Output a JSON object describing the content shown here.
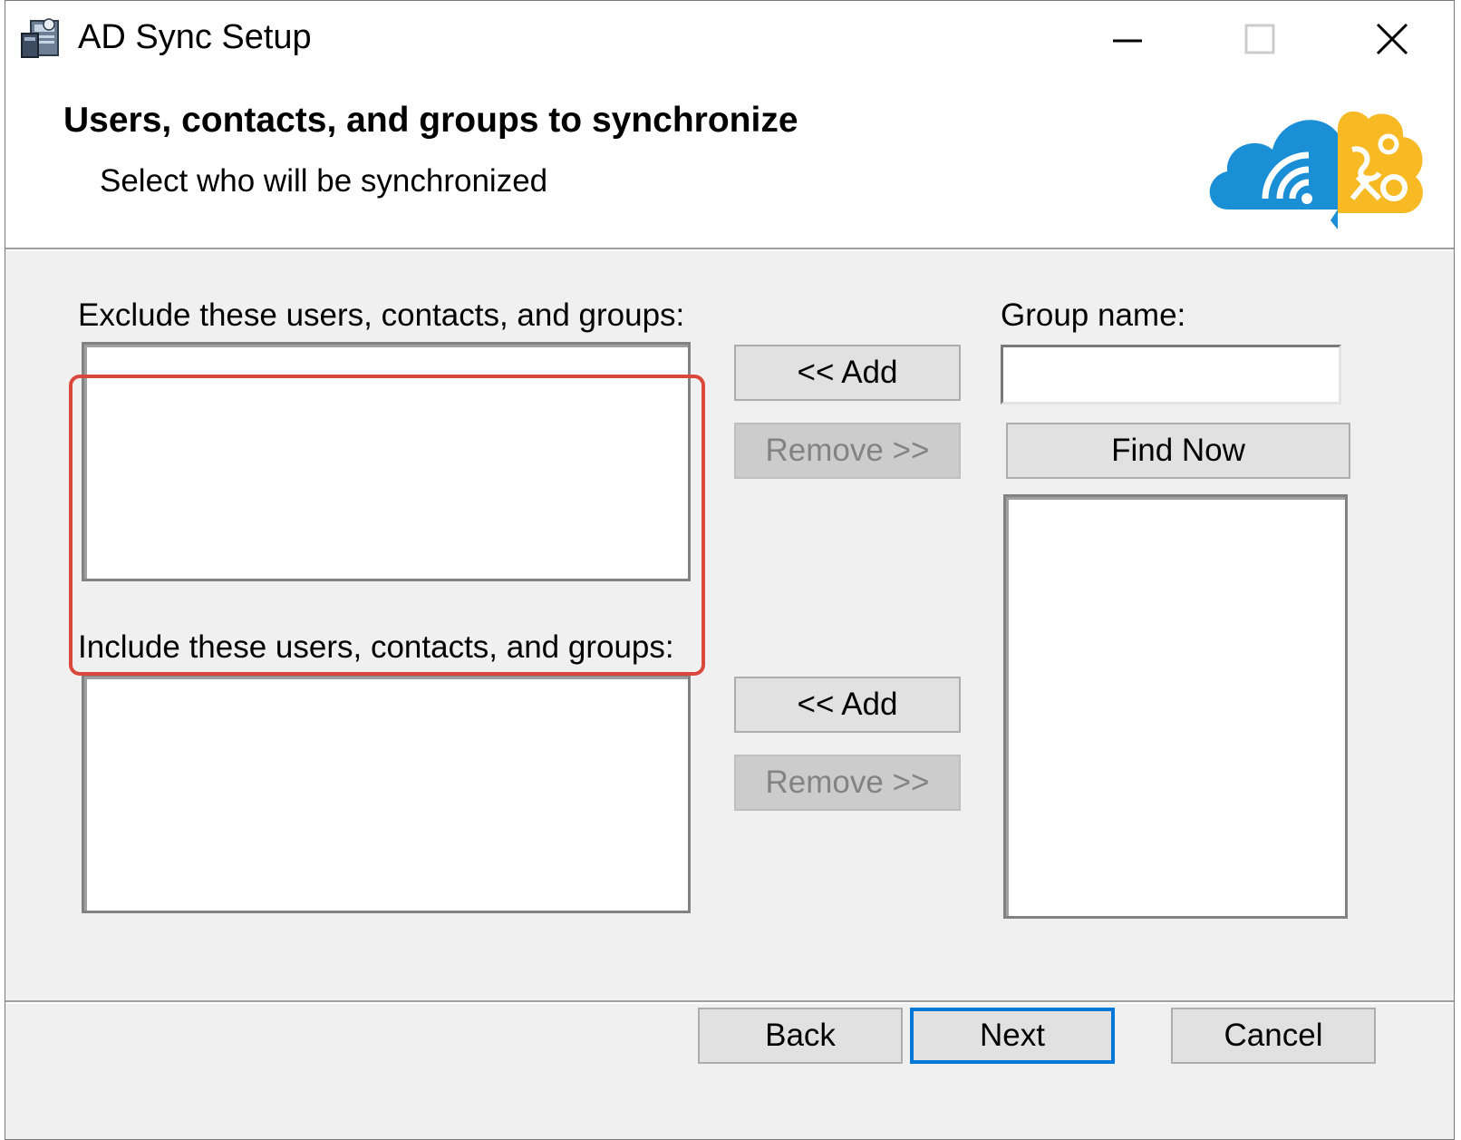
{
  "window": {
    "title": "AD Sync Setup",
    "icons": {
      "app": "installer-icon",
      "minimize": "minimize-icon",
      "maximize": "maximize-icon",
      "close": "close-icon"
    }
  },
  "header": {
    "heading": "Users, contacts, and groups to synchronize",
    "subheading": "Select who will be synchronized",
    "logo": "cloud-sync-logo"
  },
  "exclude": {
    "label": "Exclude these users, contacts, and groups:",
    "add_label": "<< Add",
    "remove_label": "Remove >>"
  },
  "include": {
    "label": "Include these users, contacts, and groups:",
    "add_label": "<< Add",
    "remove_label": "Remove >>"
  },
  "search": {
    "group_name_label": "Group name:",
    "group_name_value": "",
    "find_now_label": "Find Now"
  },
  "footer": {
    "back_label": "Back",
    "next_label": "Next",
    "cancel_label": "Cancel"
  },
  "colors": {
    "highlight": "#d9483b",
    "default_button_border": "#0078d7",
    "logo_blue": "#1a8fd6",
    "logo_yellow": "#f7b924"
  }
}
